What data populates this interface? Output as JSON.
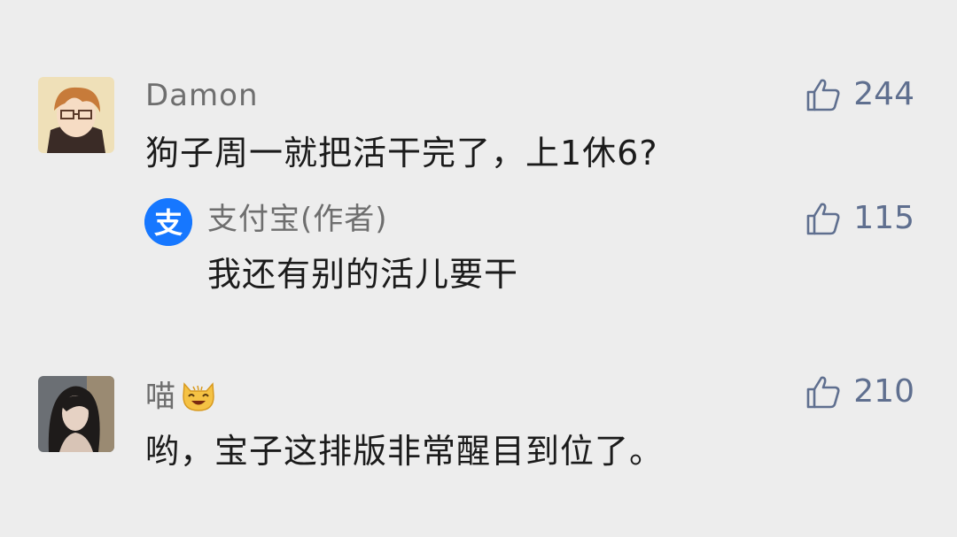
{
  "comments": [
    {
      "username": "Damon",
      "text": "狗子周一就把活干完了，上1休6?",
      "likes": "244",
      "reply": {
        "username": "支付宝(作者)",
        "avatar_glyph": "支",
        "text": "我还有别的活儿要干",
        "likes": "115"
      }
    },
    {
      "username": "喵",
      "emoji": "cat-face-emoji",
      "text": "哟，宝子这排版非常醒目到位了。",
      "likes": "210"
    }
  ],
  "icons": {
    "like": "thumbs-up-icon"
  },
  "colors": {
    "background": "#ededed",
    "alipay_blue": "#1677ff",
    "like_color": "#5f6f8f"
  }
}
